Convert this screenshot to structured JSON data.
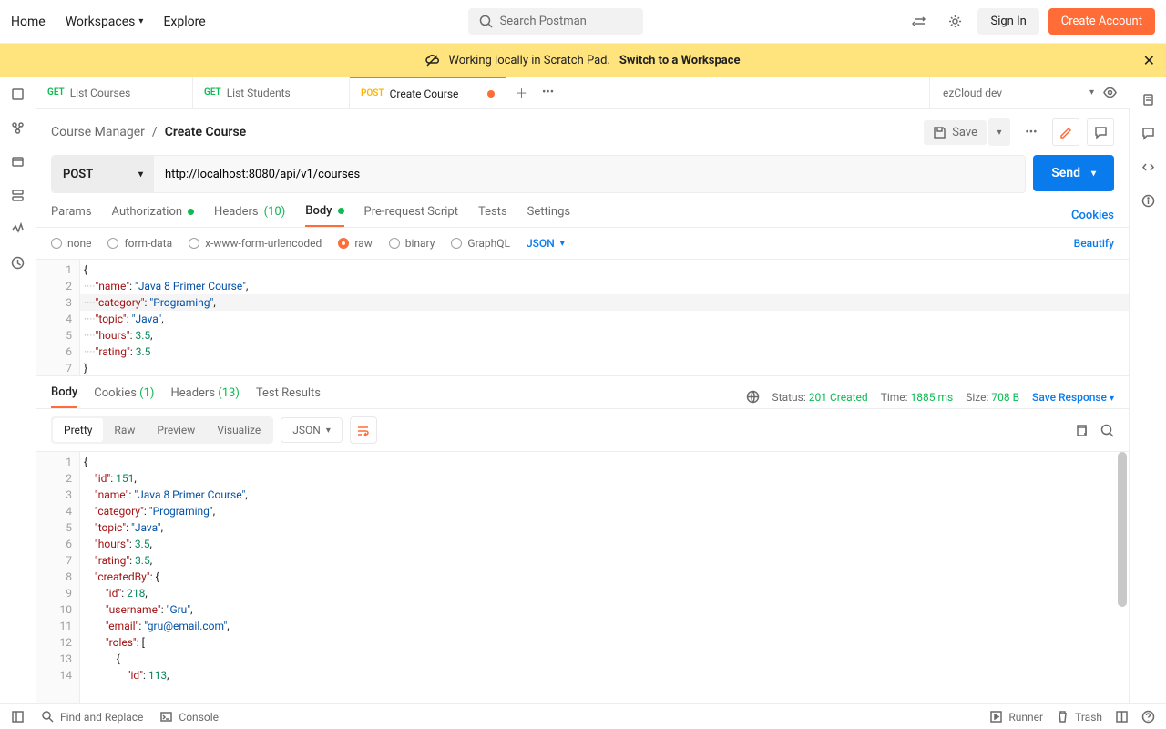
{
  "topbar": {
    "home": "Home",
    "workspaces": "Workspaces",
    "explore": "Explore",
    "search_placeholder": "Search Postman",
    "signin": "Sign In",
    "create": "Create Account"
  },
  "banner": {
    "text": "Working locally in Scratch Pad.",
    "link": "Switch to a Workspace"
  },
  "tabs": [
    {
      "method": "GET",
      "label": "List Courses"
    },
    {
      "method": "GET",
      "label": "List Students"
    },
    {
      "method": "POST",
      "label": "Create Course",
      "active": true,
      "dirty": true
    }
  ],
  "env": {
    "name": "ezCloud dev"
  },
  "breadcrumb": {
    "parent": "Course Manager",
    "current": "Create Course",
    "save": "Save"
  },
  "request": {
    "method": "POST",
    "url": "http://localhost:8080/api/v1/courses",
    "send": "Send"
  },
  "reqTabs": {
    "params": "Params",
    "auth": "Authorization",
    "headers": "Headers",
    "headers_count": "(10)",
    "body": "Body",
    "prereq": "Pre-request Script",
    "tests": "Tests",
    "settings": "Settings",
    "cookies": "Cookies"
  },
  "bodyTypes": {
    "none": "none",
    "form": "form-data",
    "xwww": "x-www-form-urlencoded",
    "raw": "raw",
    "binary": "binary",
    "graphql": "GraphQL",
    "json": "JSON",
    "beautify": "Beautify"
  },
  "reqBody": [
    {
      "n": 1,
      "t": [
        {
          "c": "p",
          "v": "{"
        }
      ]
    },
    {
      "n": 2,
      "t": [
        {
          "c": "d",
          "v": "····"
        },
        {
          "c": "k",
          "v": "\"name\""
        },
        {
          "c": "p",
          "v": ": "
        },
        {
          "c": "s",
          "v": "\"Java 8 Primer Course\""
        },
        {
          "c": "p",
          "v": ","
        }
      ]
    },
    {
      "n": 3,
      "t": [
        {
          "c": "d",
          "v": "····"
        },
        {
          "c": "k",
          "v": "\"category\""
        },
        {
          "c": "p",
          "v": ": "
        },
        {
          "c": "s",
          "v": "\"Programing\""
        },
        {
          "c": "p",
          "v": ","
        }
      ]
    },
    {
      "n": 4,
      "t": [
        {
          "c": "d",
          "v": "····"
        },
        {
          "c": "k",
          "v": "\"topic\""
        },
        {
          "c": "p",
          "v": ": "
        },
        {
          "c": "s",
          "v": "\"Java\""
        },
        {
          "c": "p",
          "v": ","
        }
      ]
    },
    {
      "n": 5,
      "t": [
        {
          "c": "d",
          "v": "····"
        },
        {
          "c": "k",
          "v": "\"hours\""
        },
        {
          "c": "p",
          "v": ": "
        },
        {
          "c": "n",
          "v": "3.5"
        },
        {
          "c": "p",
          "v": ","
        }
      ]
    },
    {
      "n": 6,
      "t": [
        {
          "c": "d",
          "v": "····"
        },
        {
          "c": "k",
          "v": "\"rating\""
        },
        {
          "c": "p",
          "v": ": "
        },
        {
          "c": "n",
          "v": "3.5"
        }
      ]
    },
    {
      "n": 7,
      "t": [
        {
          "c": "p",
          "v": "}"
        }
      ]
    }
  ],
  "respTabs": {
    "body": "Body",
    "cookies": "Cookies",
    "cookies_count": "(1)",
    "headers": "Headers",
    "headers_count": "(13)",
    "tests": "Test Results"
  },
  "respMeta": {
    "status_label": "Status:",
    "status": "201 Created",
    "time_label": "Time:",
    "time": "1885 ms",
    "size_label": "Size:",
    "size": "708 B",
    "save": "Save Response"
  },
  "respViews": {
    "pretty": "Pretty",
    "raw": "Raw",
    "preview": "Preview",
    "visualize": "Visualize",
    "json": "JSON"
  },
  "respBody": [
    {
      "n": 1,
      "t": [
        {
          "c": "p",
          "v": "{"
        }
      ]
    },
    {
      "n": 2,
      "t": [
        {
          "c": "p",
          "v": "    "
        },
        {
          "c": "k",
          "v": "\"id\""
        },
        {
          "c": "p",
          "v": ": "
        },
        {
          "c": "n",
          "v": "151"
        },
        {
          "c": "p",
          "v": ","
        }
      ]
    },
    {
      "n": 3,
      "t": [
        {
          "c": "p",
          "v": "    "
        },
        {
          "c": "k",
          "v": "\"name\""
        },
        {
          "c": "p",
          "v": ": "
        },
        {
          "c": "s",
          "v": "\"Java 8 Primer Course\""
        },
        {
          "c": "p",
          "v": ","
        }
      ]
    },
    {
      "n": 4,
      "t": [
        {
          "c": "p",
          "v": "    "
        },
        {
          "c": "k",
          "v": "\"category\""
        },
        {
          "c": "p",
          "v": ": "
        },
        {
          "c": "s",
          "v": "\"Programing\""
        },
        {
          "c": "p",
          "v": ","
        }
      ]
    },
    {
      "n": 5,
      "t": [
        {
          "c": "p",
          "v": "    "
        },
        {
          "c": "k",
          "v": "\"topic\""
        },
        {
          "c": "p",
          "v": ": "
        },
        {
          "c": "s",
          "v": "\"Java\""
        },
        {
          "c": "p",
          "v": ","
        }
      ]
    },
    {
      "n": 6,
      "t": [
        {
          "c": "p",
          "v": "    "
        },
        {
          "c": "k",
          "v": "\"hours\""
        },
        {
          "c": "p",
          "v": ": "
        },
        {
          "c": "n",
          "v": "3.5"
        },
        {
          "c": "p",
          "v": ","
        }
      ]
    },
    {
      "n": 7,
      "t": [
        {
          "c": "p",
          "v": "    "
        },
        {
          "c": "k",
          "v": "\"rating\""
        },
        {
          "c": "p",
          "v": ": "
        },
        {
          "c": "n",
          "v": "3.5"
        },
        {
          "c": "p",
          "v": ","
        }
      ]
    },
    {
      "n": 8,
      "t": [
        {
          "c": "p",
          "v": "    "
        },
        {
          "c": "k",
          "v": "\"createdBy\""
        },
        {
          "c": "p",
          "v": ": {"
        }
      ]
    },
    {
      "n": 9,
      "t": [
        {
          "c": "p",
          "v": "        "
        },
        {
          "c": "k",
          "v": "\"id\""
        },
        {
          "c": "p",
          "v": ": "
        },
        {
          "c": "n",
          "v": "218"
        },
        {
          "c": "p",
          "v": ","
        }
      ]
    },
    {
      "n": 10,
      "t": [
        {
          "c": "p",
          "v": "        "
        },
        {
          "c": "k",
          "v": "\"username\""
        },
        {
          "c": "p",
          "v": ": "
        },
        {
          "c": "s",
          "v": "\"Gru\""
        },
        {
          "c": "p",
          "v": ","
        }
      ]
    },
    {
      "n": 11,
      "t": [
        {
          "c": "p",
          "v": "        "
        },
        {
          "c": "k",
          "v": "\"email\""
        },
        {
          "c": "p",
          "v": ": "
        },
        {
          "c": "s",
          "v": "\"gru@email.com\""
        },
        {
          "c": "p",
          "v": ","
        }
      ]
    },
    {
      "n": 12,
      "t": [
        {
          "c": "p",
          "v": "        "
        },
        {
          "c": "k",
          "v": "\"roles\""
        },
        {
          "c": "p",
          "v": ": ["
        }
      ]
    },
    {
      "n": 13,
      "t": [
        {
          "c": "p",
          "v": "            {"
        }
      ]
    },
    {
      "n": 14,
      "t": [
        {
          "c": "p",
          "v": "                "
        },
        {
          "c": "k",
          "v": "\"id\""
        },
        {
          "c": "p",
          "v": ": "
        },
        {
          "c": "n",
          "v": "113"
        },
        {
          "c": "p",
          "v": ","
        }
      ]
    }
  ],
  "footer": {
    "find": "Find and Replace",
    "console": "Console",
    "runner": "Runner",
    "trash": "Trash"
  }
}
